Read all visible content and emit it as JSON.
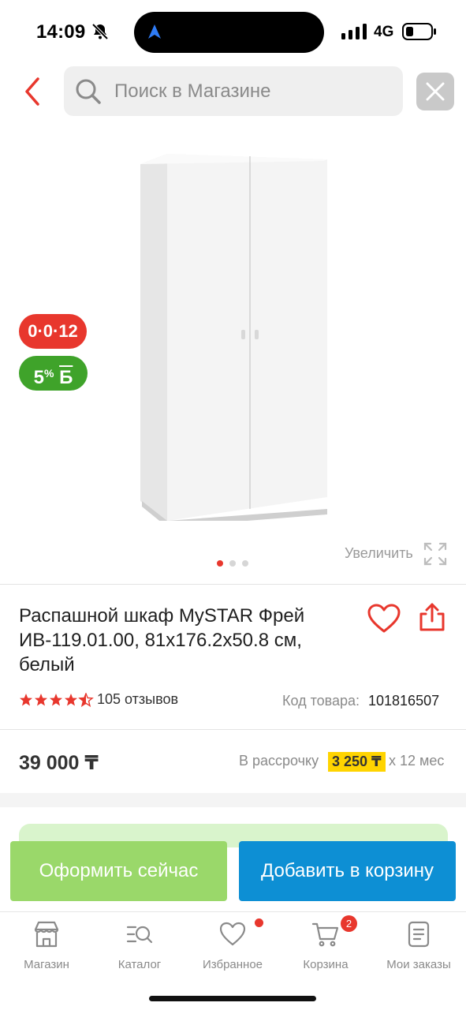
{
  "status_bar": {
    "time": "14:09",
    "network": "4G"
  },
  "search": {
    "placeholder": "Поиск в Магазине"
  },
  "gallery": {
    "badge_credit": "0·0·12",
    "badge_bonus_percent": "5",
    "badge_bonus_symbol": "%",
    "badge_bonus_unit": "Б",
    "zoom_label": "Увеличить",
    "active_slide": 1,
    "slide_count": 3
  },
  "product": {
    "title": "Распашной шкаф MySTAR Фрей ИВ-119.01.00, 81x176.2x50.8 см, белый",
    "rating": 4.5,
    "reviews": "105 отзывов",
    "sku_label": "Код товара:",
    "sku": "101816507",
    "price": "39 000 ₸",
    "installment_label": "В рассрочку",
    "installment_amount": "3 250 ₸",
    "installment_term": "x 12 мес"
  },
  "actions": {
    "checkout": "Оформить сейчас",
    "add_to_cart": "Добавить в корзину"
  },
  "tabbar": {
    "items": [
      {
        "label": "Магазин",
        "icon": "store-icon"
      },
      {
        "label": "Каталог",
        "icon": "catalog-search-icon"
      },
      {
        "label": "Избранное",
        "icon": "heart-icon"
      },
      {
        "label": "Корзина",
        "icon": "cart-icon"
      },
      {
        "label": "Мои заказы",
        "icon": "orders-icon"
      }
    ],
    "cart_count": "2"
  },
  "colors": {
    "accent_red": "#e8372d",
    "checkout_green": "#9ad86a",
    "cart_blue": "#0d8fd4",
    "installment_yellow": "#ffd400",
    "bonus_green": "#3fa32a"
  }
}
